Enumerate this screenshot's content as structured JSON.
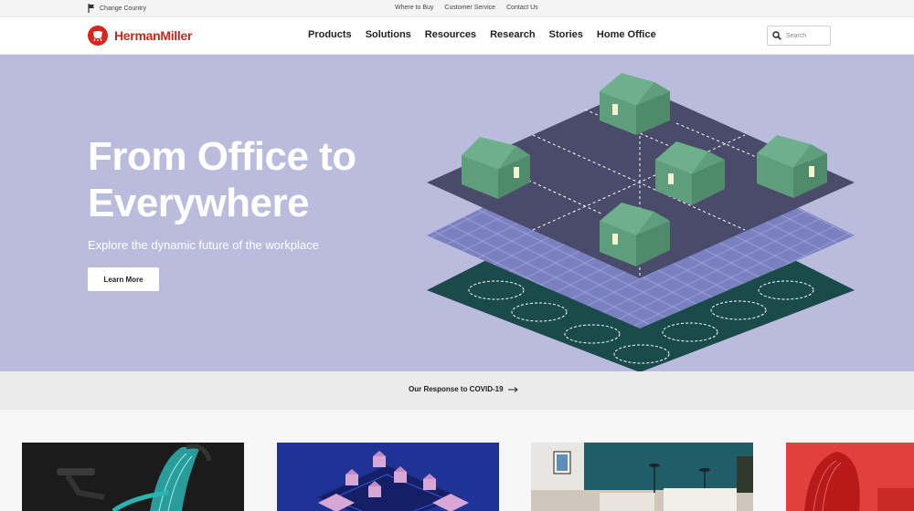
{
  "utility": {
    "change_country": "Change Country",
    "links": [
      "Where to Buy",
      "Customer Service",
      "Contact Us"
    ]
  },
  "header": {
    "logo_text": "HermanMiller",
    "nav": [
      "Products",
      "Solutions",
      "Resources",
      "Research",
      "Stories",
      "Home Office"
    ],
    "search_placeholder": "Search"
  },
  "hero": {
    "title": "From Office to Everywhere",
    "subtitle": "Explore the dynamic future of the workplace",
    "cta": "Learn More"
  },
  "covid": {
    "label": "Our Response to COVID-19"
  },
  "colors": {
    "brand_red": "#d9261c",
    "hero_bg": "#bbbbdd",
    "house_green": "#5e9e7c",
    "slab_dark": "#4a4a6a",
    "grid_blue": "#7a80c0",
    "base_teal": "#1a4a4a"
  },
  "icons": [
    "flag-icon",
    "logo-chair-icon",
    "search-icon",
    "arrow-right-icon"
  ]
}
